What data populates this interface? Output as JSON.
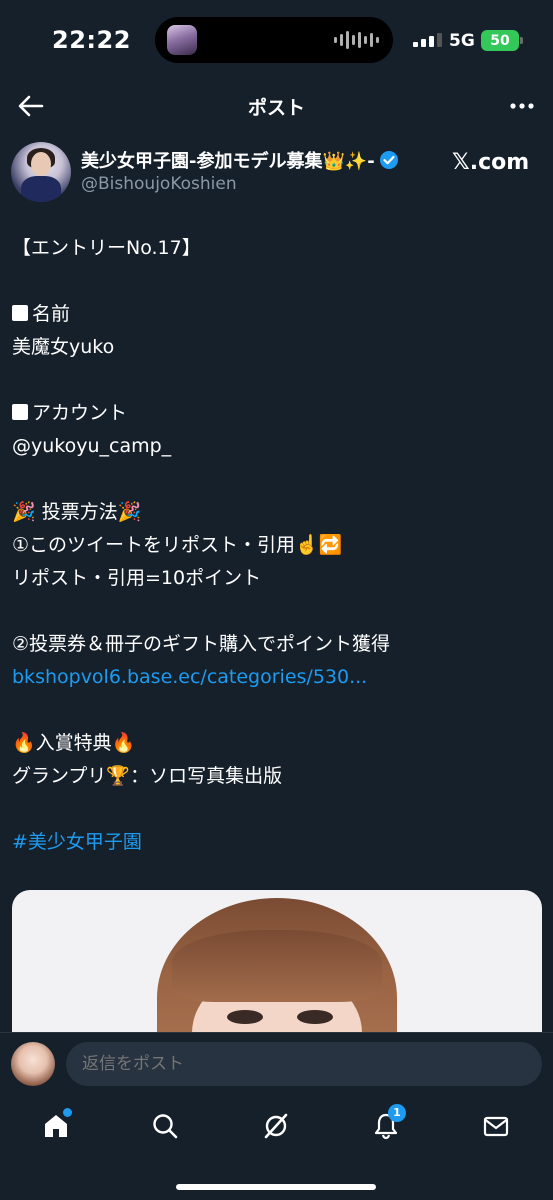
{
  "status_bar": {
    "time": "22:22",
    "network": "5G",
    "battery": "50"
  },
  "header": {
    "title": "ポスト",
    "back_icon": "arrow-left-icon",
    "more_icon": "more-horizontal-icon"
  },
  "author": {
    "name": "美少女甲子園-参加モデル募集👑✨-",
    "handle": "@BishoujoKoshien",
    "verified": true,
    "source_label": "𝕏.com"
  },
  "tweet": {
    "lines": [
      "【エントリーNo.17】",
      "",
      "名前",
      "美魔女yuko",
      "",
      "アカウント",
      "@yukoyu_camp_",
      "",
      "🎉 投票方法🎉",
      "①このツイートをリポスト・引用☝️🔁",
      "リポスト・引用=10ポイント",
      "",
      "②投票券＆冊子のギフト購入でポイント獲得",
      "bkshopvol6.base.ec/categories/530...",
      "",
      "🔥入賞特典🔥",
      "グランプリ🏆：ソロ写真集出版",
      "",
      "#美少女甲子園"
    ],
    "link": "bkshopvol6.base.ec/categories/530...",
    "hashtag": "#美少女甲子園"
  },
  "reply": {
    "placeholder": "返信をポスト"
  },
  "nav": {
    "items": [
      {
        "name": "home",
        "icon": "home-icon"
      },
      {
        "name": "search",
        "icon": "search-icon"
      },
      {
        "name": "grok",
        "icon": "grok-icon"
      },
      {
        "name": "notifications",
        "icon": "bell-icon",
        "badge": "1"
      },
      {
        "name": "messages",
        "icon": "mail-icon"
      }
    ]
  },
  "colors": {
    "background": "#15202b",
    "link": "#1d9bf0",
    "secondary_text": "#8b98a5"
  }
}
